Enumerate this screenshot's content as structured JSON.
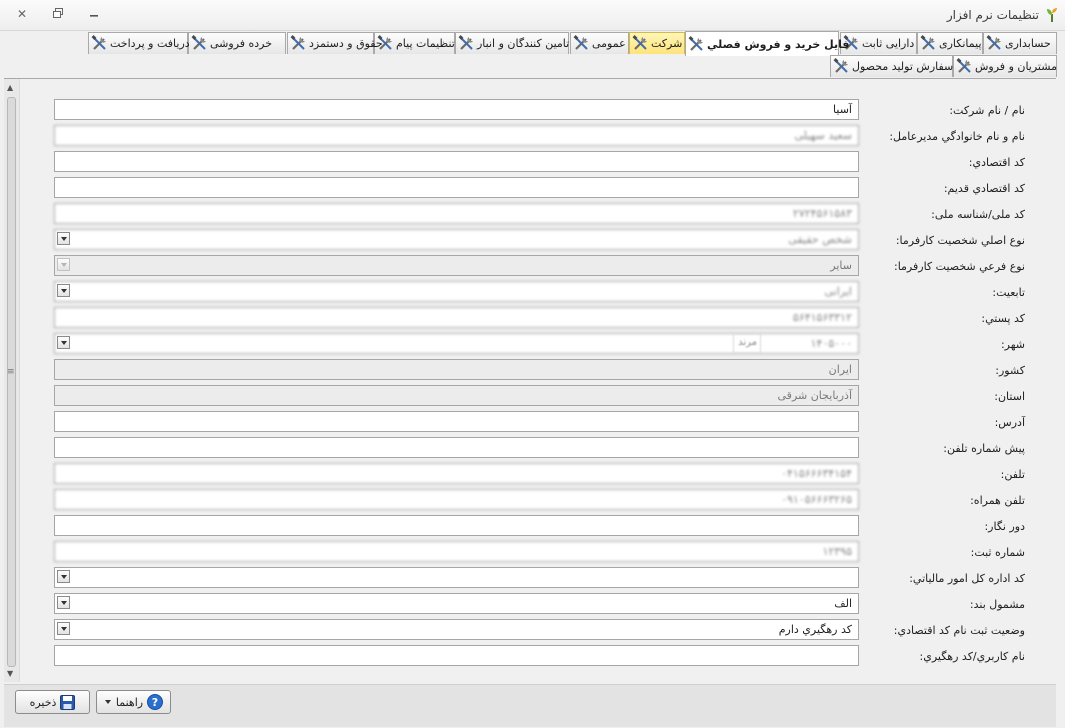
{
  "window": {
    "title": "تنظیمات نرم افزار"
  },
  "tabs_row1": [
    {
      "label": "حسابداری"
    },
    {
      "label": "پیمانکاری"
    },
    {
      "label": "دارایی ثابت"
    },
    {
      "label": "فایل خرید و فروش فصلي",
      "active": true
    },
    {
      "label": "شرکت",
      "highlighted": true
    },
    {
      "label": "عمومی"
    },
    {
      "label": "تامین کنندگان و انبار"
    },
    {
      "label": "تنظیمات پیام"
    },
    {
      "label": "حقوق و دستمزد"
    },
    {
      "label": "خرده فروشی"
    },
    {
      "label": "دریافت و پرداخت"
    }
  ],
  "tabs_row2": [
    {
      "label": "مشتریان و فروش"
    },
    {
      "label": "سفارش تولید محصول"
    }
  ],
  "form": [
    {
      "label": "نام / نام شرکت:",
      "value": "آسیا"
    },
    {
      "label": "نام و نام خانوادگي مديرعامل:",
      "value": "سعید سهیلی"
    },
    {
      "label": "کد اقتصادي:",
      "value": ""
    },
    {
      "label": "کد اقتصادي قدیم:",
      "value": ""
    },
    {
      "label": "کد ملی/شناسه ملی:",
      "value": "۲۷۲۴۵۶۱۵۸۳"
    },
    {
      "label": "نوع اصلي شخصيت کارفرما:",
      "value": "شخص حقیقی"
    },
    {
      "label": "نوع فرعي شخصيت کارفرما:",
      "value": "سایر"
    },
    {
      "label": "تابعيت:",
      "value": "ایرانی"
    },
    {
      "label": "کد پستي:",
      "value": "۵۶۴۱۵۶۳۳۱۲"
    },
    {
      "label": "شهر:",
      "value": "۱۴۰۵۰۰۰",
      "sub": "مرند"
    },
    {
      "label": "کشور:",
      "value": "ایران"
    },
    {
      "label": "استان:",
      "value": "آذربایجان شرقی"
    },
    {
      "label": "آدرس:",
      "value": ""
    },
    {
      "label": "پيش شماره تلفن:",
      "value": ""
    },
    {
      "label": "تلفن:",
      "value": "۰۴۱۵۶۶۶۳۴۱۵۴"
    },
    {
      "label": "تلفن همراه:",
      "value": "۰۹۱۰۵۶۶۶۳۲۶۵"
    },
    {
      "label": "دور نگار:",
      "value": ""
    },
    {
      "label": "شماره ثبت:",
      "value": "۱۲۳۹۵"
    },
    {
      "label": "کد اداره کل امور مالياتي:",
      "value": ""
    },
    {
      "label": "مشمول بند:",
      "value": "الف"
    },
    {
      "label": "وضعیت ثبت نام کد اقتصادي:",
      "value": "کد رهگیري دارم"
    },
    {
      "label": "نام کاربري/کد رهگيري:",
      "value": ""
    }
  ],
  "buttons": {
    "save": "ذخیره",
    "help": "راهنما"
  },
  "icons": [
    "settings-app-icon",
    "tools-icon",
    "save-icon",
    "help-icon"
  ]
}
